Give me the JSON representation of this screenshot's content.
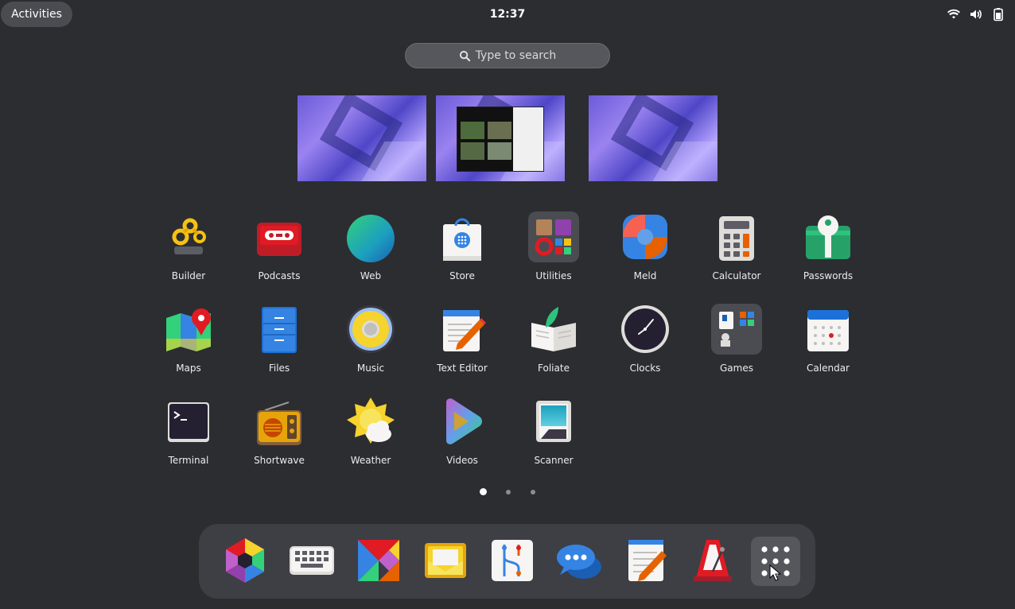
{
  "topbar": {
    "activities_label": "Activities",
    "clock": "12:37",
    "tray_icons": [
      "wifi-icon",
      "volume-icon",
      "battery-icon"
    ]
  },
  "search": {
    "placeholder": "Type to search"
  },
  "workspaces": [
    "workspace-1",
    "workspace-2",
    "workspace-3"
  ],
  "apps": [
    {
      "label": "Builder"
    },
    {
      "label": "Podcasts"
    },
    {
      "label": "Web"
    },
    {
      "label": "Store"
    },
    {
      "label": "Utilities"
    },
    {
      "label": "Meld"
    },
    {
      "label": "Calculator"
    },
    {
      "label": "Passwords"
    },
    {
      "label": "Maps"
    },
    {
      "label": "Files"
    },
    {
      "label": "Music"
    },
    {
      "label": "Text Editor"
    },
    {
      "label": "Foliate"
    },
    {
      "label": "Clocks"
    },
    {
      "label": "Games"
    },
    {
      "label": "Calendar"
    },
    {
      "label": "Terminal"
    },
    {
      "label": "Shortwave"
    },
    {
      "label": "Weather"
    },
    {
      "label": "Videos"
    },
    {
      "label": "Scanner"
    }
  ],
  "pages": {
    "count": 3,
    "active": 1
  },
  "dock": [
    "software-icon",
    "keyboard-icon",
    "tangram-icon",
    "mail-icon",
    "git-icon",
    "chat-icon",
    "notes-icon",
    "metronome-icon",
    "show-apps-icon"
  ]
}
